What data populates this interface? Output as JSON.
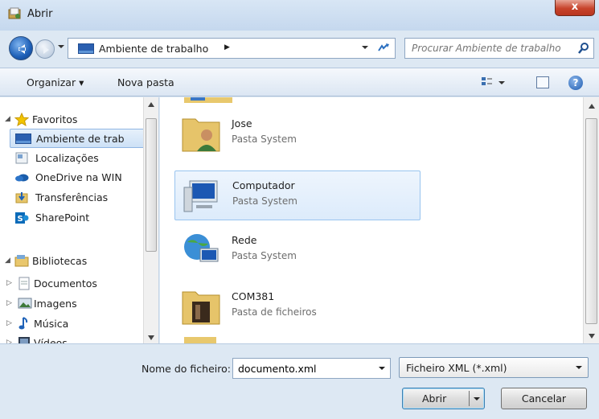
{
  "window": {
    "title": "Abrir",
    "close_label": "x",
    "accent": "#1d5fb7",
    "close_color": "#c7432b"
  },
  "address": {
    "path": "Ambiente de trabalho",
    "path_arrow": "▶"
  },
  "search": {
    "placeholder": "Procurar Ambiente de trabalho"
  },
  "commandbar": {
    "organize_label": "Organizar ▾",
    "new_folder_label": "Nova pasta",
    "help_label": "?"
  },
  "nav": {
    "favorites_label": "Favoritos",
    "favorites": [
      "Ambiente de trab",
      "Localizações",
      "OneDrive na WIN",
      "Transferências",
      "SharePoint"
    ],
    "libraries_label": "Bibliotecas",
    "libraries": [
      "Documentos",
      "Imagens",
      "Música",
      "Vídeos"
    ]
  },
  "files": [
    {
      "name": "Jose",
      "type": "Pasta System",
      "icon": "user-folder-icon"
    },
    {
      "name": "Computador",
      "type": "Pasta System",
      "icon": "computer-icon",
      "selected": true
    },
    {
      "name": "Rede",
      "type": "Pasta System",
      "icon": "network-icon"
    },
    {
      "name": "COM381",
      "type": "Pasta de ficheiros",
      "icon": "folder-icon"
    }
  ],
  "bottom": {
    "filename_label": "Nome do ficheiro:",
    "filename_value": "documento.xml",
    "filetype_value": "Ficheiro XML (*.xml)",
    "open_label": "Abrir",
    "cancel_label": "Cancelar"
  }
}
